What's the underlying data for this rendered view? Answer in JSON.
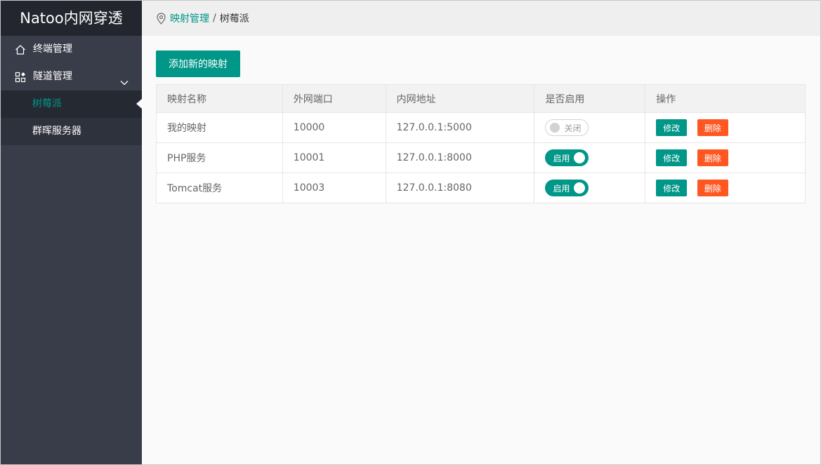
{
  "app": {
    "title": "Natoo内网穿透"
  },
  "sidebar": {
    "items": [
      {
        "label": "终端管理",
        "icon": "home-icon"
      },
      {
        "label": "隧道管理",
        "icon": "apps-icon",
        "expanded": true,
        "children": [
          {
            "label": "树莓派",
            "active": true
          },
          {
            "label": "群晖服务器",
            "active": false
          }
        ]
      }
    ]
  },
  "breadcrumb": {
    "parent": "映射管理",
    "separator": "/",
    "current": "树莓派"
  },
  "main": {
    "add_button": "添加新的映射",
    "table": {
      "headers": [
        "映射名称",
        "外网端口",
        "内网地址",
        "是否启用",
        "操作"
      ],
      "rows": [
        {
          "name": "我的映射",
          "port": "10000",
          "address": "127.0.0.1:5000",
          "enabled": false,
          "switch_label": "关闭",
          "edit": "修改",
          "delete": "删除"
        },
        {
          "name": "PHP服务",
          "port": "10001",
          "address": "127.0.0.1:8000",
          "enabled": true,
          "switch_label": "启用",
          "edit": "修改",
          "delete": "删除"
        },
        {
          "name": "Tomcat服务",
          "port": "10003",
          "address": "127.0.0.1:8080",
          "enabled": true,
          "switch_label": "启用",
          "edit": "修改",
          "delete": "删除"
        }
      ]
    }
  },
  "colors": {
    "accent": "#009688",
    "danger": "#ff5722",
    "sidebar": "#393d49",
    "logo_bg": "#23262e"
  }
}
